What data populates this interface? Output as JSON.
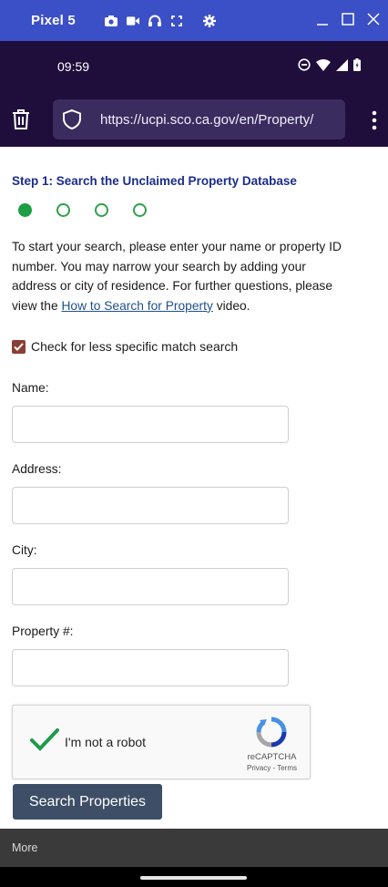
{
  "emulator": {
    "title": "Pixel 5"
  },
  "status_bar": {
    "time": "09:59"
  },
  "browser": {
    "url": "https://ucpi.sco.ca.gov/en/Property/"
  },
  "page": {
    "step_title": "Step 1: Search the Unclaimed Property Database",
    "progress": {
      "steps_total": 4,
      "current_step": 1
    },
    "intro_text": "To start your search, please enter your name or property ID number. You may narrow your search by adding your address or city of residence. For further questions, please view the ",
    "intro_link": "How to Search for Property",
    "intro_suffix": " video.",
    "less_specific_label": "Check for less specific match search",
    "less_specific_checked": true,
    "fields": [
      {
        "label": "Name:",
        "value": ""
      },
      {
        "label": "Address:",
        "value": ""
      },
      {
        "label": "City:",
        "value": ""
      },
      {
        "label": "Property #:",
        "value": ""
      }
    ],
    "captcha": {
      "label": "I'm not a robot",
      "brand": "reCAPTCHA",
      "privacy": "Privacy",
      "separator": " - ",
      "terms": "Terms"
    },
    "search_button": "Search Properties"
  },
  "bottom_bar": {
    "more_label": "More"
  },
  "colors": {
    "emulator_bar": "#3b4fc6",
    "status_bar": "#1f0d3b",
    "step_title": "#1c2c8c",
    "progress_green": "#1f9e42",
    "checkbox": "#8a3f34",
    "button": "#3d4e66"
  }
}
